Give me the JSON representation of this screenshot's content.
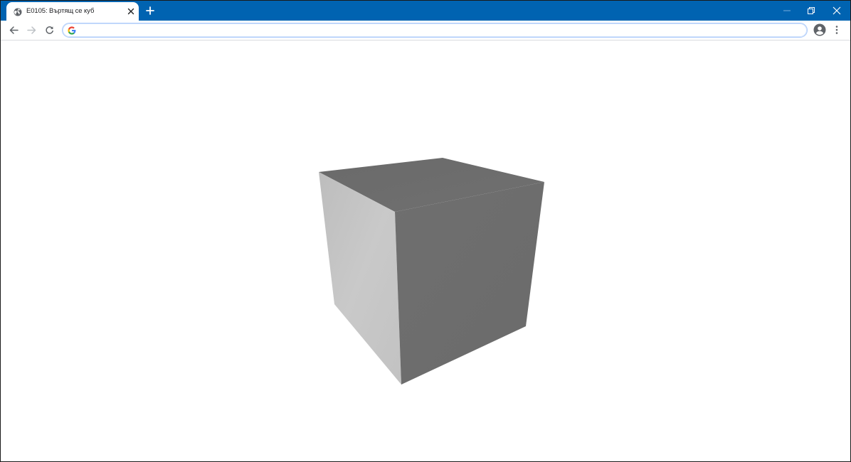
{
  "browser": {
    "tab": {
      "title": "E0105: Въртящ се куб",
      "favicon": "globe-icon"
    },
    "new_tab_icon": "plus-icon",
    "window_controls": [
      "minimize-icon",
      "restore-icon",
      "close-icon"
    ],
    "toolbar": {
      "nav_icons": [
        "arrow-left-icon",
        "arrow-right-icon",
        "reload-icon"
      ],
      "omnibox": {
        "value": "",
        "icon": "google-g-icon"
      },
      "profile_icon": "account-circle-icon",
      "menu_icon": "vertical-dots-icon"
    },
    "colors": {
      "tabstrip": "#0063b1",
      "tab": "#ffffff",
      "omnibox_border": "#aecbfa"
    }
  },
  "page": {
    "scene": {
      "object": "cube",
      "colors": {
        "top_face": "#6c6c6c",
        "front_face": "#6e6e6e",
        "left_face": "#c5c5c5",
        "background": "#ffffff"
      }
    }
  }
}
